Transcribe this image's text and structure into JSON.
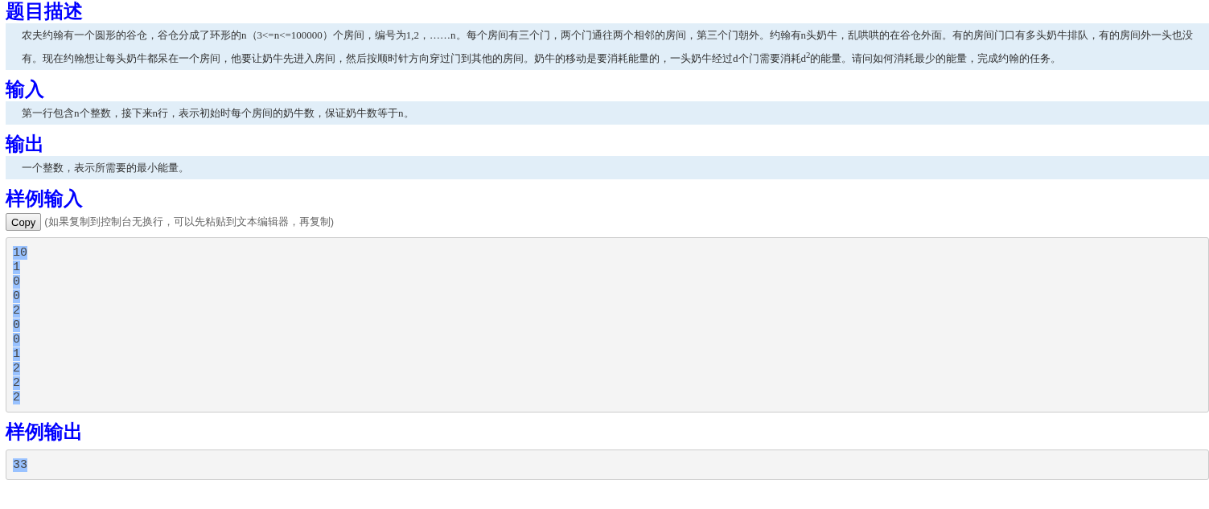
{
  "sections": [
    {
      "kind": "text",
      "heading": "题目描述",
      "text": "农夫约翰有一个圆形的谷仓，谷仓分成了环形的n（3<=n<=100000）个房间，编号为1,2，……n。每个房间有三个门，两个门通往两个相邻的房间，第三个门朝外。约翰有n头奶牛，乱哄哄的在谷仓外面。有的房间门口有多头奶牛排队，有的房间外一头也没有。现在约翰想让每头奶牛都呆在一个房间，他要让奶牛先进入房间，然后按顺时针方向穿过门到其他的房间。奶牛的移动是要消耗能量的，一头奶牛经过d个门需要消耗d$^{2}$的能量。请问如何消耗最少的能量，完成约翰的任务。"
    },
    {
      "kind": "text",
      "heading": "输入",
      "text": "第一行包含n个整数，接下来n行，表示初始时每个房间的奶牛数，保证奶牛数等于n。"
    },
    {
      "kind": "text",
      "heading": "输出",
      "text": "一个整数，表示所需要的最小能量。"
    },
    {
      "kind": "sample",
      "heading": "样例输入",
      "copy_button": "Copy",
      "copy_note": "(如果复制到控制台无换行，可以先粘贴到文本编辑器，再复制)",
      "lines": [
        "10",
        "1",
        "0",
        "0",
        "2",
        "0",
        "0",
        "1",
        "2",
        "2",
        "2"
      ],
      "selected": true
    },
    {
      "kind": "sample",
      "heading": "样例输出",
      "lines": [
        "33"
      ],
      "selected": true
    }
  ]
}
